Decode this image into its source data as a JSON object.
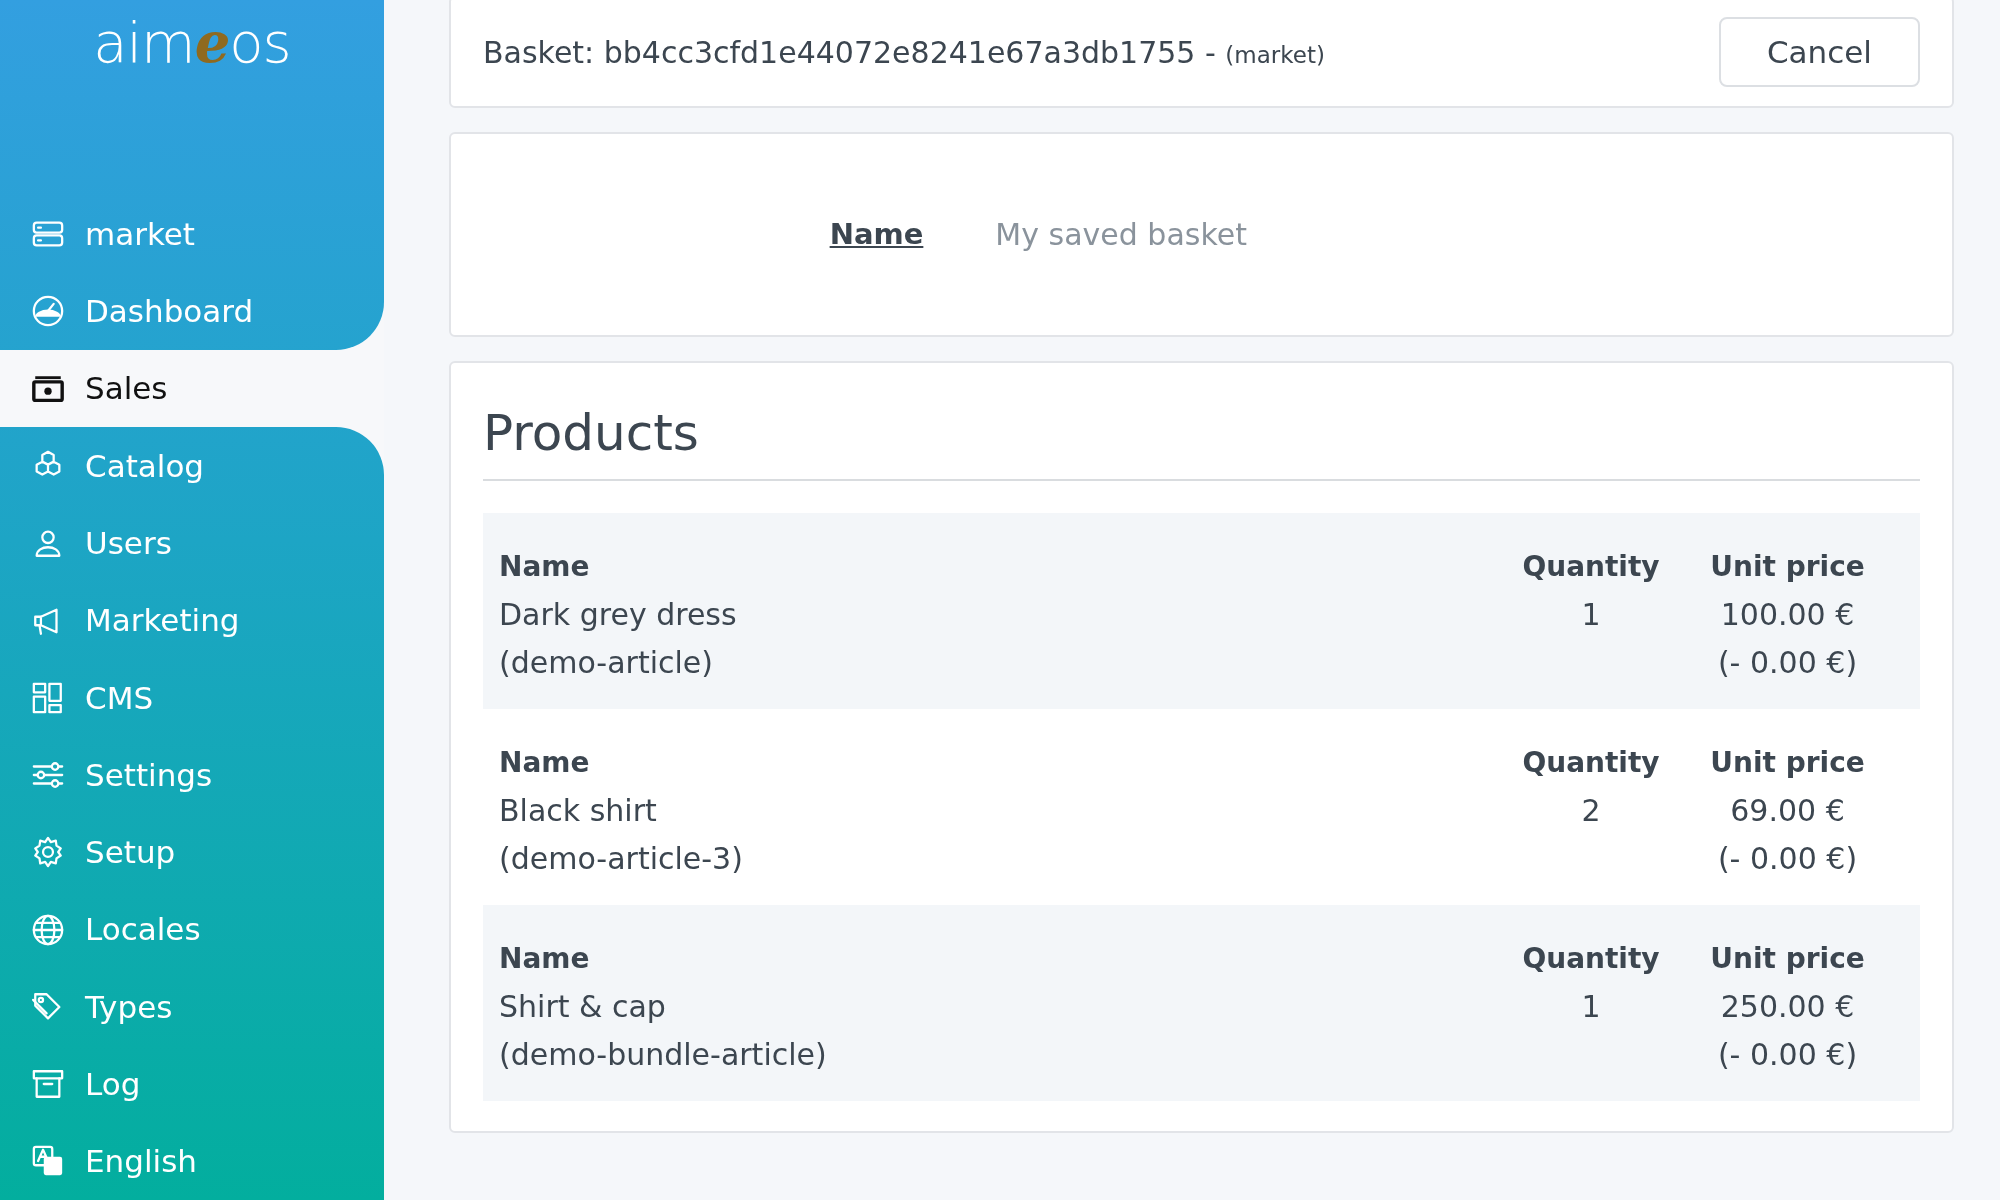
{
  "sidebar": {
    "logo": "aimeos",
    "items": [
      {
        "label": "market",
        "selected": false
      },
      {
        "label": "Dashboard",
        "selected": false
      },
      {
        "label": "Sales",
        "selected": true
      },
      {
        "label": "Catalog",
        "selected": false
      },
      {
        "label": "Users",
        "selected": false
      },
      {
        "label": "Marketing",
        "selected": false
      },
      {
        "label": "CMS",
        "selected": false
      },
      {
        "label": "Settings",
        "selected": false
      },
      {
        "label": "Setup",
        "selected": false
      },
      {
        "label": "Locales",
        "selected": false
      },
      {
        "label": "Types",
        "selected": false
      },
      {
        "label": "Log",
        "selected": false
      },
      {
        "label": "English",
        "selected": false
      }
    ]
  },
  "header": {
    "title": "Basket: bb4cc3cfd1e44072e8241e67a3db1755 -",
    "site": "(market)",
    "cancel_button": "Cancel"
  },
  "name_field": {
    "label": "Name",
    "placeholder": "My saved basket"
  },
  "products": {
    "title": "Products",
    "rows": [
      {
        "name_label": "Name",
        "name": "Dark grey dress",
        "code": "(demo-article)",
        "quantity_label": "Quantity",
        "quantity": "1",
        "price_label": "Unit price",
        "price": "100.00 €",
        "rebate": "(- 0.00 €)"
      },
      {
        "name_label": "Name",
        "name": "Black shirt",
        "code": "(demo-article-3)",
        "quantity_label": "Quantity",
        "quantity": "2",
        "price_label": "Unit price",
        "price": "69.00 €",
        "rebate": "(- 0.00 €)"
      },
      {
        "name_label": "Name",
        "name": "Shirt & cap",
        "code": "(demo-bundle-article)",
        "quantity_label": "Quantity",
        "quantity": "1",
        "price_label": "Unit price",
        "price": "250.00 €",
        "rebate": "(- 0.00 €)"
      }
    ]
  }
}
